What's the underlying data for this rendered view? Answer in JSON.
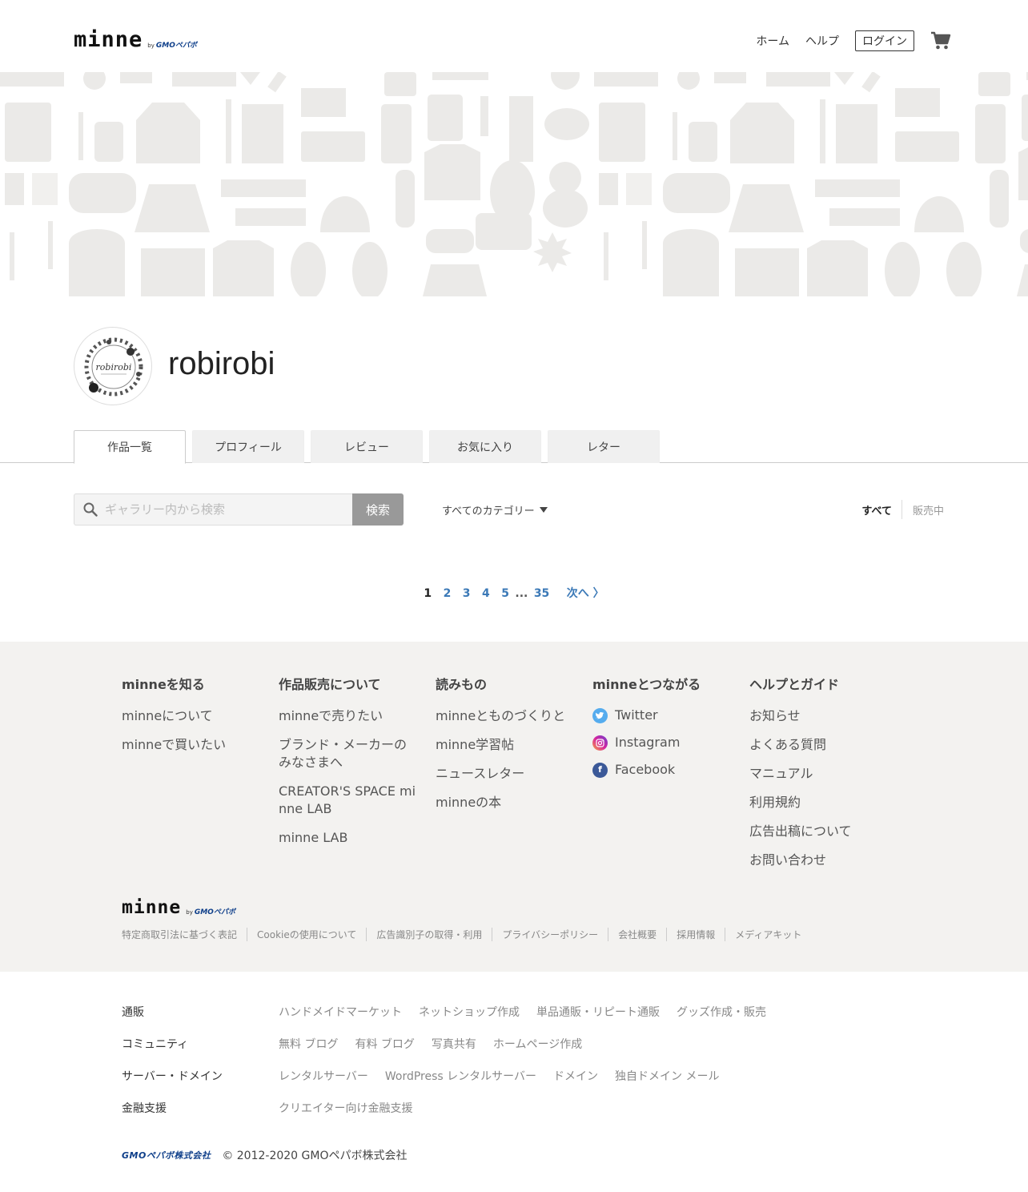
{
  "header": {
    "logo": "minne",
    "logo_by": "by",
    "logo_gmo": "GMOペパボ",
    "nav": {
      "home": "ホーム",
      "help": "ヘルプ",
      "login": "ログイン"
    },
    "cart_icon": "cart-icon"
  },
  "profile": {
    "name": "robirobi",
    "avatar_text": "robirobi"
  },
  "tabs": [
    "作品一覧",
    "プロフィール",
    "レビュー",
    "お気に入り",
    "レター"
  ],
  "search": {
    "placeholder": "ギャラリー内から検索",
    "button": "検索",
    "category": "すべてのカテゴリー",
    "filter_all": "すべて",
    "filter_selling": "販売中"
  },
  "pagination": {
    "pages": [
      "1",
      "2",
      "3",
      "4",
      "5"
    ],
    "dots": "...",
    "last": "35",
    "next": "次へ 〉"
  },
  "footer": {
    "cols": [
      {
        "title": "minneを知る",
        "links": [
          "minneについて",
          "minneで買いたい"
        ]
      },
      {
        "title": "作品販売について",
        "links": [
          "minneで売りたい",
          "ブランド・メーカーのみなさまへ",
          "CREATOR'S SPACE minne LAB",
          "minne LAB"
        ]
      },
      {
        "title": "読みもの",
        "links": [
          "minneとものづくりと",
          "minne学習帖",
          "ニュースレター",
          "minneの本"
        ]
      },
      {
        "title": "minneとつながる",
        "links": [
          "Twitter",
          "Instagram",
          "Facebook"
        ]
      },
      {
        "title": "ヘルプとガイド",
        "links": [
          "お知らせ",
          "よくある質問",
          "マニュアル",
          "利用規約",
          "広告出稿について",
          "お問い合わせ"
        ]
      }
    ],
    "legal": [
      "特定商取引法に基づく表記",
      "Cookieの使用について",
      "広告識別子の取得・利用",
      "プライバシーポリシー",
      "会社概要",
      "採用情報",
      "メディアキット"
    ]
  },
  "group": {
    "rows": [
      {
        "head": "通販",
        "links": [
          "ハンドメイドマーケット",
          "ネットショップ作成",
          "単品通販・リピート通販",
          "グッズ作成・販売"
        ]
      },
      {
        "head": "コミュニティ",
        "links": [
          "無料 ブログ",
          "有料 ブログ",
          "写真共有",
          "ホームページ作成"
        ]
      },
      {
        "head": "サーバー・ドメイン",
        "links": [
          "レンタルサーバー",
          "WordPress レンタルサーバー",
          "ドメイン",
          "独自ドメイン メール"
        ]
      },
      {
        "head": "金融支援",
        "links": [
          "クリエイター向け金融支援"
        ]
      }
    ],
    "company_logo": "GMOペパボ株式会社",
    "copyright": "© 2012-2020 GMOペパボ株式会社"
  },
  "colors": {
    "link": "#3b79b7",
    "footer_bg": "#f3f2f0",
    "search_btn": "#999999",
    "gmo_blue": "#0f3f8a"
  }
}
